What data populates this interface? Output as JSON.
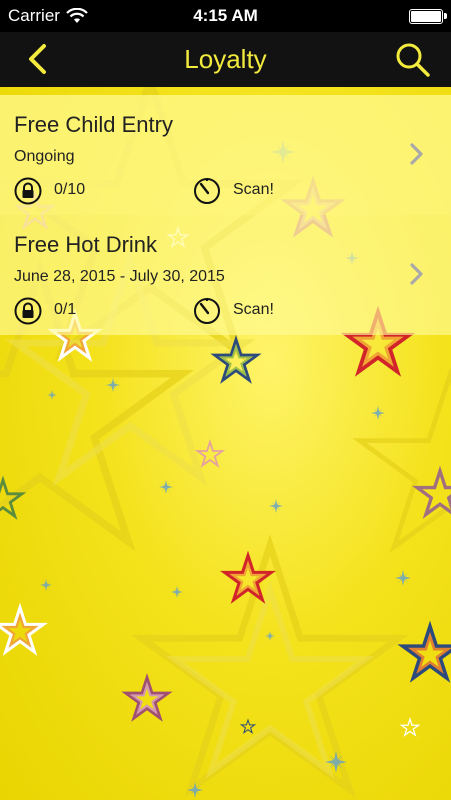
{
  "status_bar": {
    "carrier": "Carrier",
    "time": "4:15 AM"
  },
  "nav": {
    "title": "Loyalty",
    "back_icon": "chevron-left-icon",
    "search_icon": "magnifier-icon",
    "accent_color": "#f3ea3e"
  },
  "loyalty_items": [
    {
      "title": "Free Child Entry",
      "subtitle": "Ongoing",
      "progress": "0/10",
      "action": "Scan!"
    },
    {
      "title": "Free Hot Drink",
      "subtitle": "June 28, 2015 - July 30, 2015",
      "progress": "0/1",
      "action": "Scan!"
    }
  ]
}
